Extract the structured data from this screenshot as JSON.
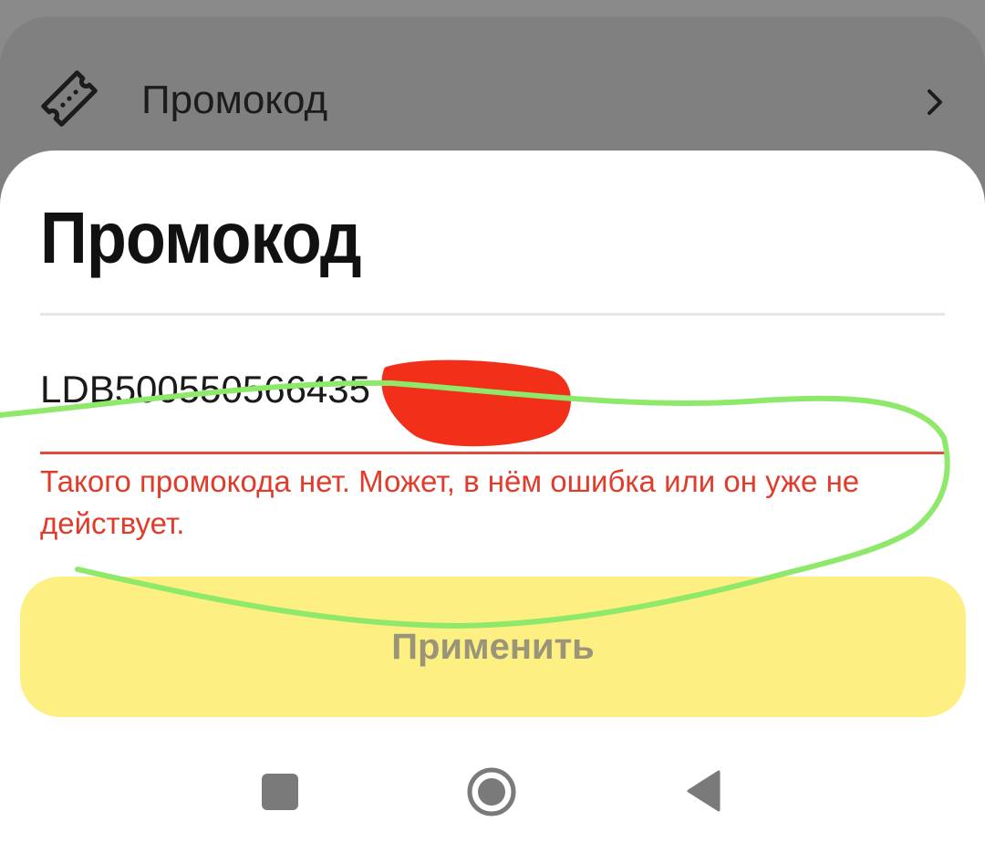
{
  "background_row": {
    "label": "Промокод",
    "icon": "ticket-icon",
    "chevron": "chevron-right-icon"
  },
  "sheet": {
    "title": "Промокод",
    "input_value": "LDB500550566435",
    "error_message": "Такого промокода нет. Может, в нём ошибка или он уже не действует.",
    "apply_label": "Применить"
  },
  "nav": {
    "recents": "square-icon",
    "home": "home-circle-icon",
    "back": "back-triangle-icon"
  },
  "colors": {
    "error": "#e13b2b",
    "button": "#fdef82",
    "highlight_stroke": "#8ee86a",
    "redaction": "#f2301a"
  }
}
